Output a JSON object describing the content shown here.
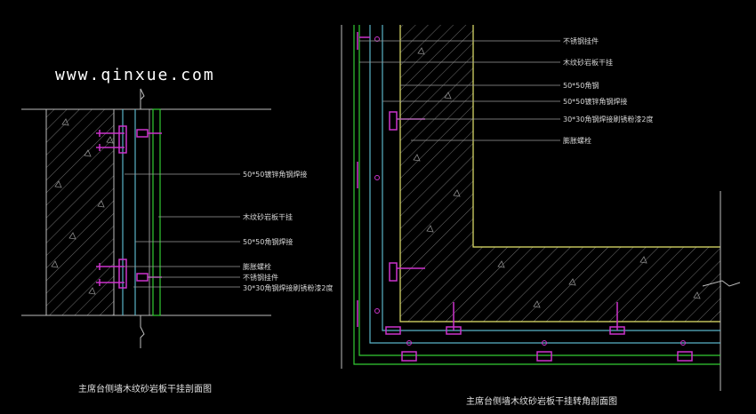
{
  "watermark": "www.qinxue.com",
  "left_drawing": {
    "title": "主席台侧墙木纹砂岩板干挂剖面图",
    "labels": [
      "50*50镀锌角钢焊接",
      "木纹砂岩板干挂",
      "50*50角钢焊接",
      "膨胀螺栓",
      "不锈钢挂件",
      "30*30角钢焊接刷锈粉漆2度"
    ]
  },
  "right_drawing": {
    "title": "主席台侧墙木纹砂岩板干挂转角剖面图",
    "labels": [
      "不锈钢挂件",
      "木纹砂岩板干挂",
      "50*50角钢",
      "50*50镀锌角钢焊接",
      "30*30角钢焊接刷锈粉漆2度",
      "膨胀螺栓"
    ]
  },
  "colors": {
    "background": "#000000",
    "wall_line": "#bcbcbc",
    "hatch": "#7a7a7a",
    "stone_panel": "#33cc33",
    "steel": "#5ab4c8",
    "bracket": "#cc33cc",
    "face_line": "#e6e66e",
    "leader": "#9a9a9a"
  }
}
